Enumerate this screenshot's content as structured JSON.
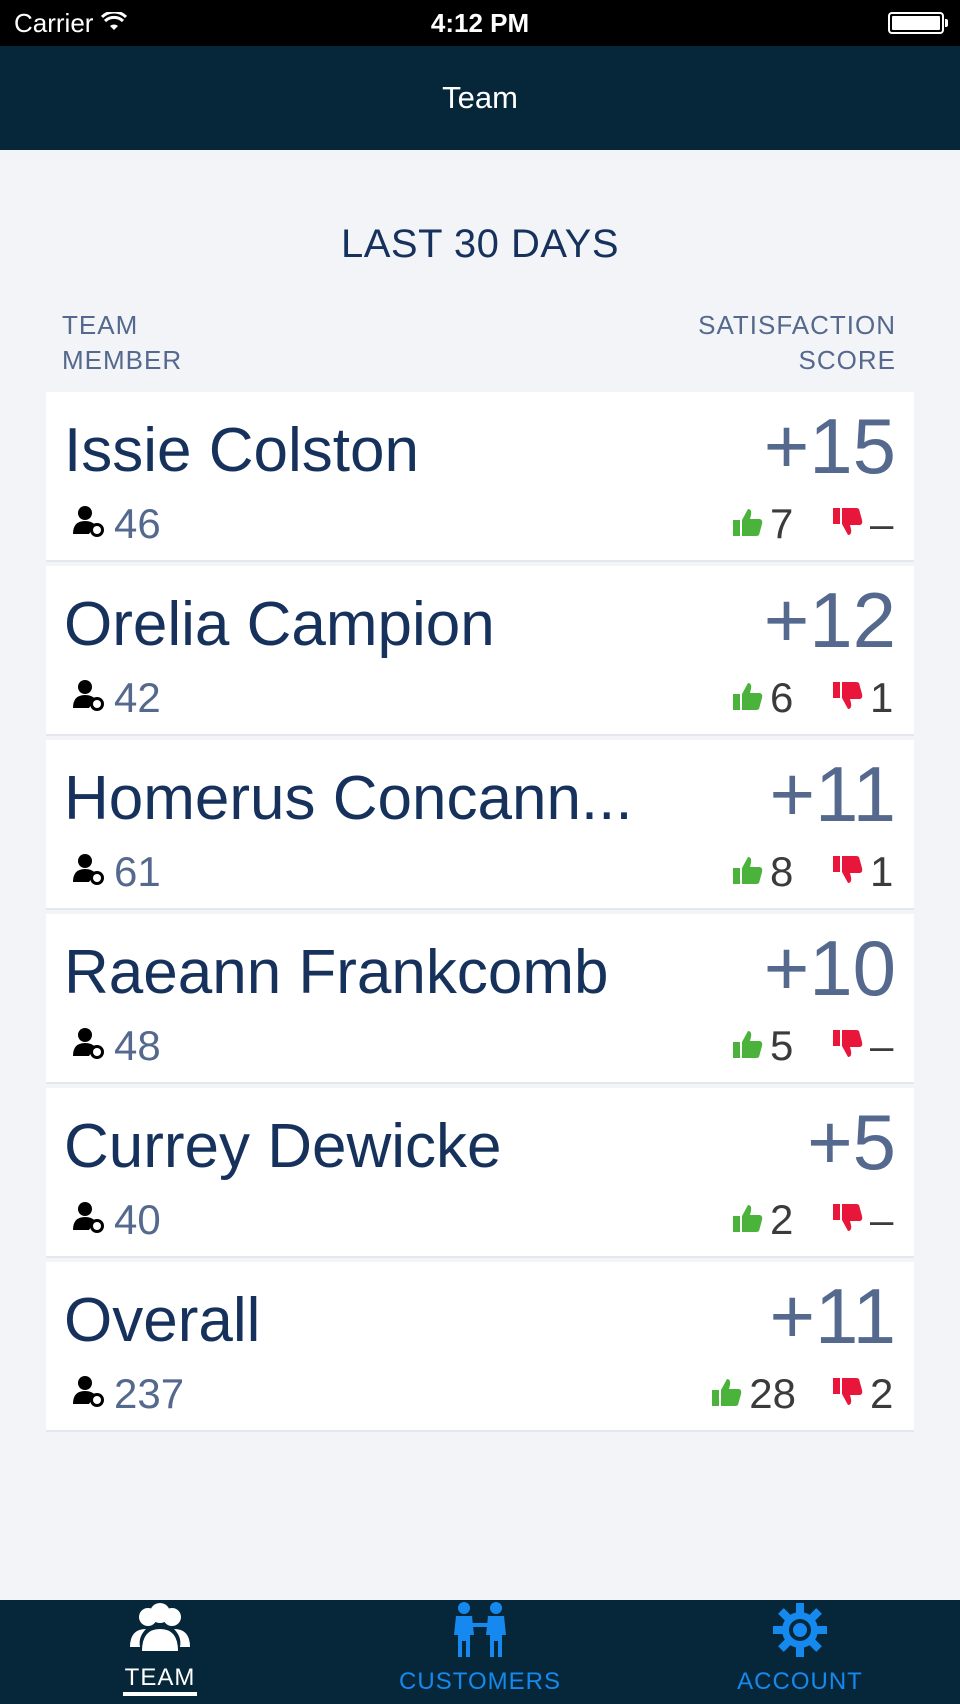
{
  "status_bar": {
    "carrier": "Carrier",
    "time": "4:12 PM"
  },
  "nav": {
    "title": "Team"
  },
  "period_label": "LAST 30 DAYS",
  "columns": {
    "member_line1": "TEAM",
    "member_line2": "MEMBER",
    "score_line1": "SATISFACTION",
    "score_line2": "SCORE"
  },
  "members": [
    {
      "name": "Issie Colston",
      "score": "+15",
      "customers": "46",
      "up": "7",
      "down": "–"
    },
    {
      "name": "Orelia Campion",
      "score": "+12",
      "customers": "42",
      "up": "6",
      "down": "1"
    },
    {
      "name": "Homerus Concann...",
      "score": "+11",
      "customers": "61",
      "up": "8",
      "down": "1"
    },
    {
      "name": "Raeann Frankcomb",
      "score": "+10",
      "customers": "48",
      "up": "5",
      "down": "–"
    },
    {
      "name": "Currey Dewicke",
      "score": "+5",
      "customers": "40",
      "up": "2",
      "down": "–"
    },
    {
      "name": "Overall",
      "score": "+11",
      "customers": "237",
      "up": "28",
      "down": "2"
    }
  ],
  "tabs": [
    {
      "label": "TEAM",
      "icon": "team-icon",
      "active": true
    },
    {
      "label": "CUSTOMERS",
      "icon": "customers-icon",
      "active": false
    },
    {
      "label": "ACCOUNT",
      "icon": "gear-icon",
      "active": false
    }
  ],
  "colors": {
    "navy": "#06273a",
    "title": "#16325c",
    "muted": "#54698d",
    "up": "#4bb33b",
    "down": "#e8163a",
    "tab_accent": "#1589ee"
  }
}
